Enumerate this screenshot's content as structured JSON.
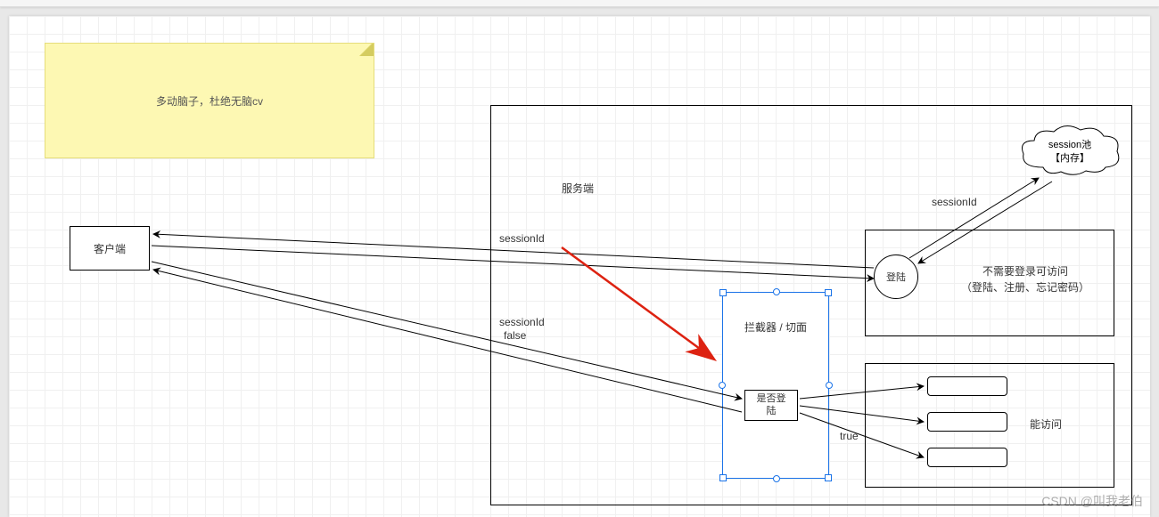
{
  "note": {
    "text": "多动脑子，杜绝无脑cv"
  },
  "client": {
    "label": "客户端"
  },
  "server": {
    "label": "服务端"
  },
  "interceptor": {
    "label": "拦截器 /  切面"
  },
  "decision": {
    "label": "是否登\n陆"
  },
  "login": {
    "label": "登陆"
  },
  "noauth": {
    "line1": "不需要登录可访问",
    "line2": "（登陆、注册、忘记密码）"
  },
  "pool": {
    "line1": "session池",
    "line2": "【内存】"
  },
  "auth_area": {
    "label": "能访问"
  },
  "edges": {
    "sessionId1": "sessionId",
    "sessionId2": "sessionId",
    "sessionId3": "sessionId",
    "false": "false",
    "true": "true"
  },
  "watermark": "CSDN @叫我老伯"
}
